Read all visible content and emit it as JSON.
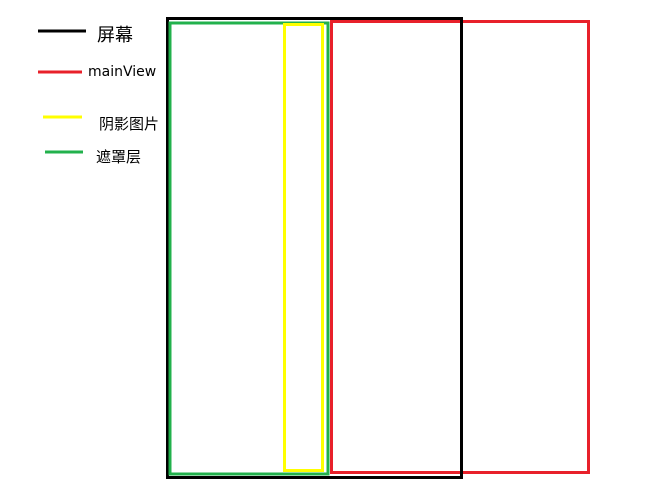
{
  "legend": [
    {
      "label": "屏幕",
      "color": "#000000"
    },
    {
      "label": "mainView",
      "color": "#e8202a"
    },
    {
      "label": "阴影图片",
      "color": "#ffff00"
    },
    {
      "label": "遮罩层",
      "color": "#22b14c"
    }
  ],
  "boxes": {
    "screen_color": "#000000",
    "mainview_color": "#e8202a",
    "shadow_color": "#ffff00",
    "mask_color": "#22b14c"
  }
}
